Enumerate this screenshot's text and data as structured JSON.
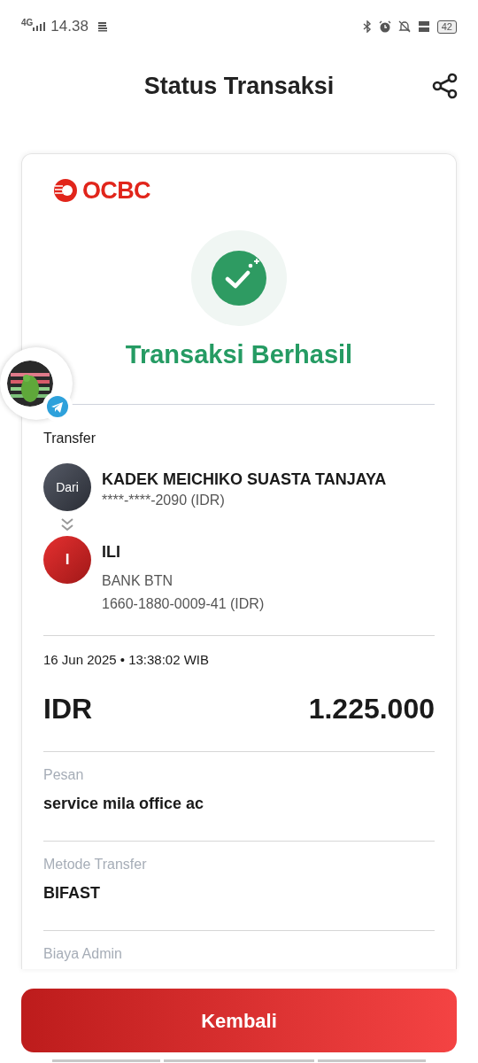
{
  "status_bar": {
    "network": "4G",
    "time": "14.38",
    "battery": "42"
  },
  "header": {
    "title": "Status Transaksi"
  },
  "receipt": {
    "logo_text": "OCBC",
    "status": "Transaksi Berhasil",
    "type": "Transfer",
    "from": {
      "avatar_text": "Dari",
      "name": "KADEK MEICHIKO SUASTA TANJAYA",
      "account": "****-****-2090 (IDR)"
    },
    "to": {
      "avatar_text": "I",
      "name": "ILI",
      "bank": "BANK BTN",
      "account": "1660-1880-0009-41 (IDR)"
    },
    "datetime": "16 Jun 2025 • 13:38:02 WIB",
    "currency": "IDR",
    "amount": "1.225.000",
    "fields": [
      {
        "label": "Pesan",
        "value": "service mila office ac"
      },
      {
        "label": "Metode Transfer",
        "value": "BIFAST"
      },
      {
        "label": "Biaya Admin"
      }
    ]
  },
  "button": "Kembali"
}
